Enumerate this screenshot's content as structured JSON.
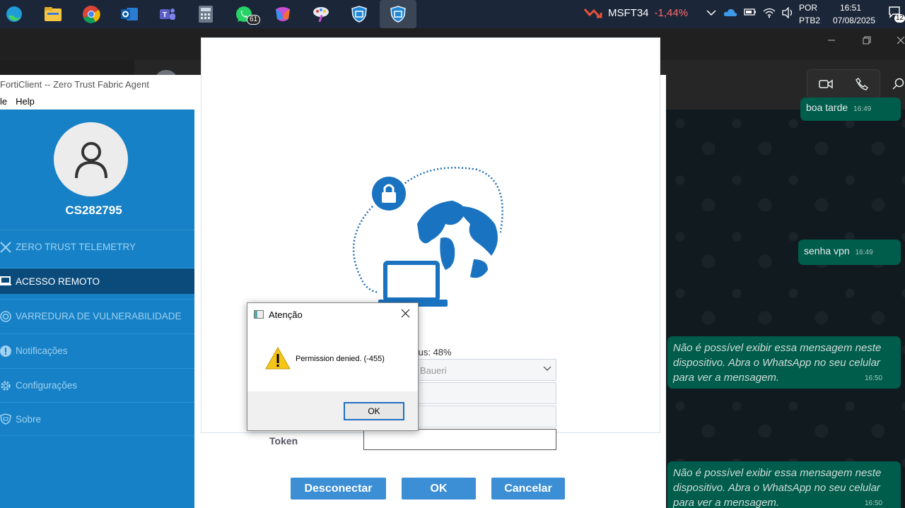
{
  "taskbar": {
    "apps": [
      {
        "icon": "edge-icon"
      },
      {
        "icon": "file-explorer-icon"
      },
      {
        "icon": "chrome-icon"
      },
      {
        "icon": "outlook-icon"
      },
      {
        "icon": "teams-icon"
      },
      {
        "icon": "calculator-icon"
      },
      {
        "icon": "whatsapp-icon",
        "badge": "61"
      },
      {
        "icon": "m365-icon"
      },
      {
        "icon": "paint-icon"
      },
      {
        "icon": "forticlient-icon"
      },
      {
        "icon": "forticlient-active-icon"
      }
    ],
    "stock": {
      "symbol": "MSFT34",
      "change": "-1,44%"
    },
    "lang": {
      "line1": "POR",
      "line2": "PTB2"
    },
    "clock": {
      "time": "16:51",
      "date": "07/08/2025"
    },
    "notif_badge": "12"
  },
  "whatsapp": {
    "messages": [
      {
        "text": "boa tarde",
        "time": "16:49"
      },
      {
        "text": "senha vpn",
        "time": "16:49"
      },
      {
        "text": "Não é possível exibir essa mensagem neste dispositivo. Abra o WhatsApp no seu celular para ver a mensagem.",
        "time": "16:50"
      },
      {
        "text": "Não é possível exibir essa mensagem neste dispositivo. Abra o WhatsApp no seu celular para ver a mensagem.",
        "time": "16:50"
      }
    ]
  },
  "forticlient": {
    "title": "FortiClient -- Zero Trust Fabric Agent",
    "menu": [
      "le",
      "Help"
    ],
    "user": "CS282795",
    "nav": [
      {
        "label": "ZERO TRUST TELEMETRY"
      },
      {
        "label": "ACESSO REMOTO"
      },
      {
        "label": "VARREDURA DE VULNERABILIDADE"
      },
      {
        "label": "Notificações"
      },
      {
        "label": "Configurações"
      },
      {
        "label": "Sobre"
      }
    ],
    "status": "tus: 48%",
    "vpn_select": "Baueri",
    "token_label": "Token",
    "buttons": {
      "disconnect": "Desconectar",
      "ok": "OK",
      "cancel": "Cancelar"
    }
  },
  "dialog": {
    "title": "Atenção",
    "message": "Permission denied. (-455)",
    "ok": "OK"
  },
  "colors": {
    "sidebar": "#1681c6",
    "sidebar_active": "#0b4b7c",
    "button": "#3c8fd4",
    "bubble": "#005c4b",
    "stock_negative": "#ff6b6b"
  }
}
